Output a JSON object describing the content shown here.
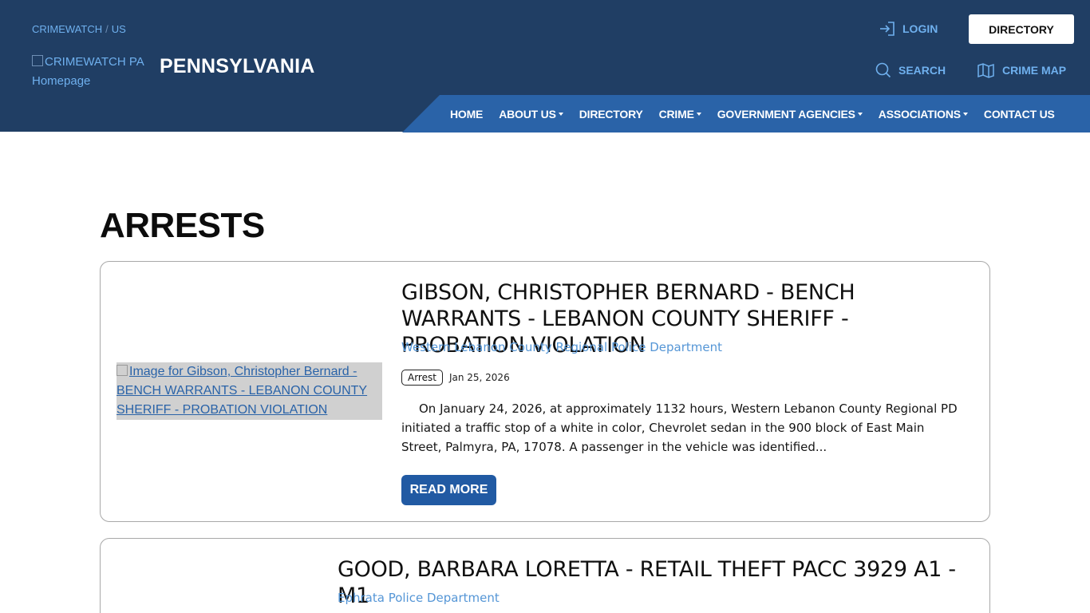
{
  "header": {
    "breadcrumb": {
      "root": "CRIMEWATCH",
      "separator": "/",
      "current": "US"
    },
    "logo_alt": "CRIMEWATCH PA Homepage",
    "state_name": "PENNSYLVANIA",
    "login_label": "LOGIN",
    "directory_button": "DIRECTORY",
    "search_label": "SEARCH",
    "crime_map_label": "CRIME MAP",
    "nav": [
      {
        "label": "HOME",
        "dropdown": false
      },
      {
        "label": "ABOUT US",
        "dropdown": true
      },
      {
        "label": "DIRECTORY",
        "dropdown": false
      },
      {
        "label": "CRIME",
        "dropdown": true
      },
      {
        "label": "GOVERNMENT AGENCIES",
        "dropdown": true
      },
      {
        "label": "ASSOCIATIONS",
        "dropdown": true
      },
      {
        "label": "CONTACT US",
        "dropdown": false
      }
    ]
  },
  "main": {
    "title": "ARRESTS",
    "posts": [
      {
        "image_alt": "Image for Gibson, Christopher Bernard - BENCH WARRANTS - LEBANON COUNTY SHERIFF - PROBATION VIOLATION",
        "title": "GIBSON, CHRISTOPHER BERNARD - BENCH WARRANTS - LEBANON COUNTY SHERIFF - PROBATION VIOLATION",
        "agency": "Western Lebanon County Regional Police Department",
        "tag": "Arrest",
        "date": "Jan 25, 2026",
        "excerpt": "On January 24, 2026, at approximately 1132 hours, Western Lebanon County Regional PD initiated a traffic stop of a white in color, Chevrolet sedan in the 900 block of East Main Street, Palmyra, PA, 17078.  A passenger in the vehicle was identified...",
        "read_more": "READ MORE"
      },
      {
        "title": "GOOD, BARBARA LORETTA - RETAIL THEFT PACC 3929 A1 - M1",
        "agency": "Ephrata Police Department"
      }
    ]
  },
  "colors": {
    "header_bg": "#203e64",
    "nav_bg": "#2a63a8",
    "link_blue": "#6fb0ee",
    "button_blue": "#215aa3"
  }
}
